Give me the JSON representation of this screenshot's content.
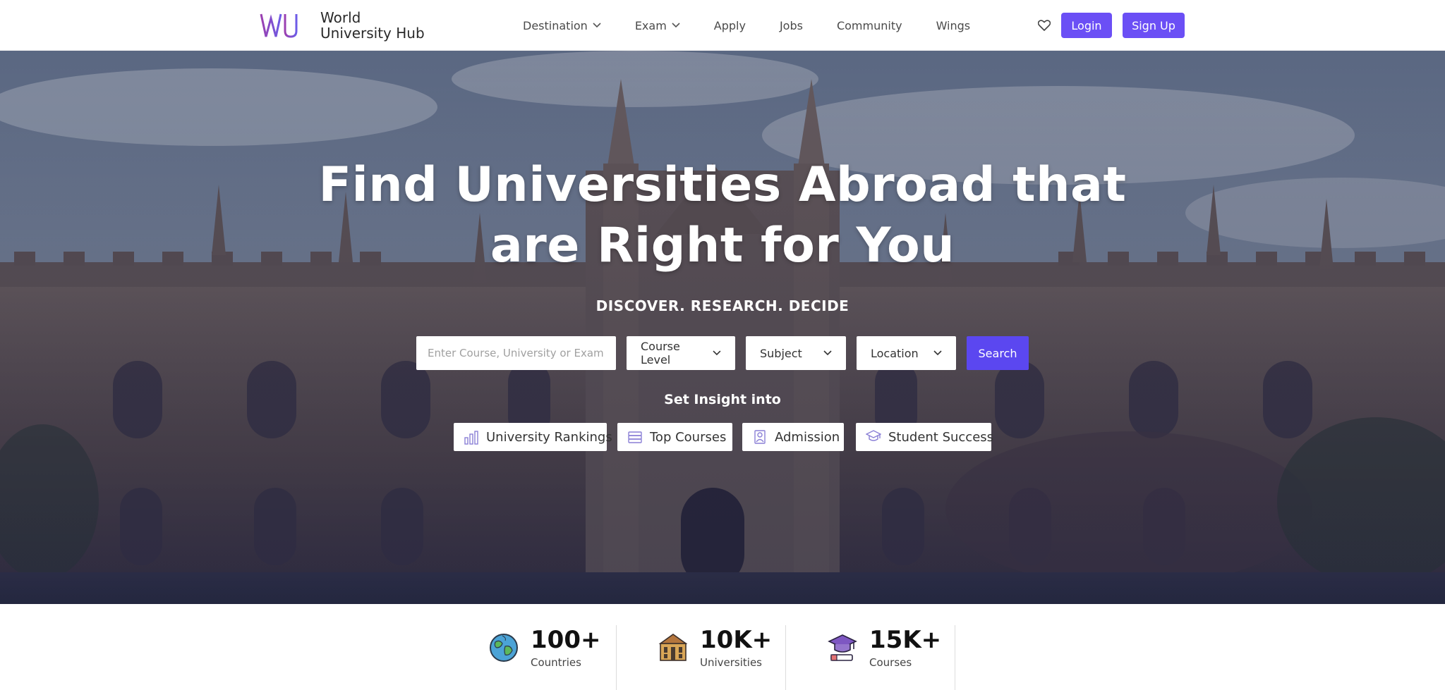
{
  "brand": {
    "logo_mark": "WUH",
    "name_line1": "World",
    "name_line2": "University Hub",
    "colors": {
      "logo_gradient_start": "#8e44ad",
      "logo_gradient_end": "#6c5ce7"
    }
  },
  "nav": {
    "items": [
      {
        "label": "Destination",
        "has_dropdown": true
      },
      {
        "label": "Exam",
        "has_dropdown": true
      },
      {
        "label": "Apply",
        "has_dropdown": false
      },
      {
        "label": "Jobs",
        "has_dropdown": false
      },
      {
        "label": "Community",
        "has_dropdown": false
      },
      {
        "label": "Wings",
        "has_dropdown": false
      }
    ],
    "wishlist_icon": "heart-icon",
    "login_label": "Login",
    "signup_label": "Sign Up",
    "button_color": "#6b4ff5"
  },
  "hero": {
    "title_line1": "Find Universities Abroad that",
    "title_line2": "are Right for You",
    "tagline": "DISCOVER. RESEARCH. DECIDE",
    "search": {
      "placeholder": "Enter Course, University or Exam",
      "value": "",
      "course_level": "Course Level",
      "subject": "Subject",
      "location": "Location",
      "button_label": "Search",
      "button_color": "#5b47f0"
    },
    "insight_label": "Set Insight into",
    "chips": [
      {
        "label": "University Rankings",
        "icon": "bar-chart-icon"
      },
      {
        "label": "Top Courses",
        "icon": "books-icon"
      },
      {
        "label": "Admission",
        "icon": "admission-icon"
      },
      {
        "label": "Student Success",
        "icon": "graduate-icon"
      }
    ]
  },
  "stats": [
    {
      "value": "100+",
      "label": "Countries",
      "icon": "globe-icon"
    },
    {
      "value": "10K+",
      "label": "Universities",
      "icon": "university-building-icon"
    },
    {
      "value": "15K+",
      "label": "Courses",
      "icon": "graduation-cap-icon"
    }
  ]
}
